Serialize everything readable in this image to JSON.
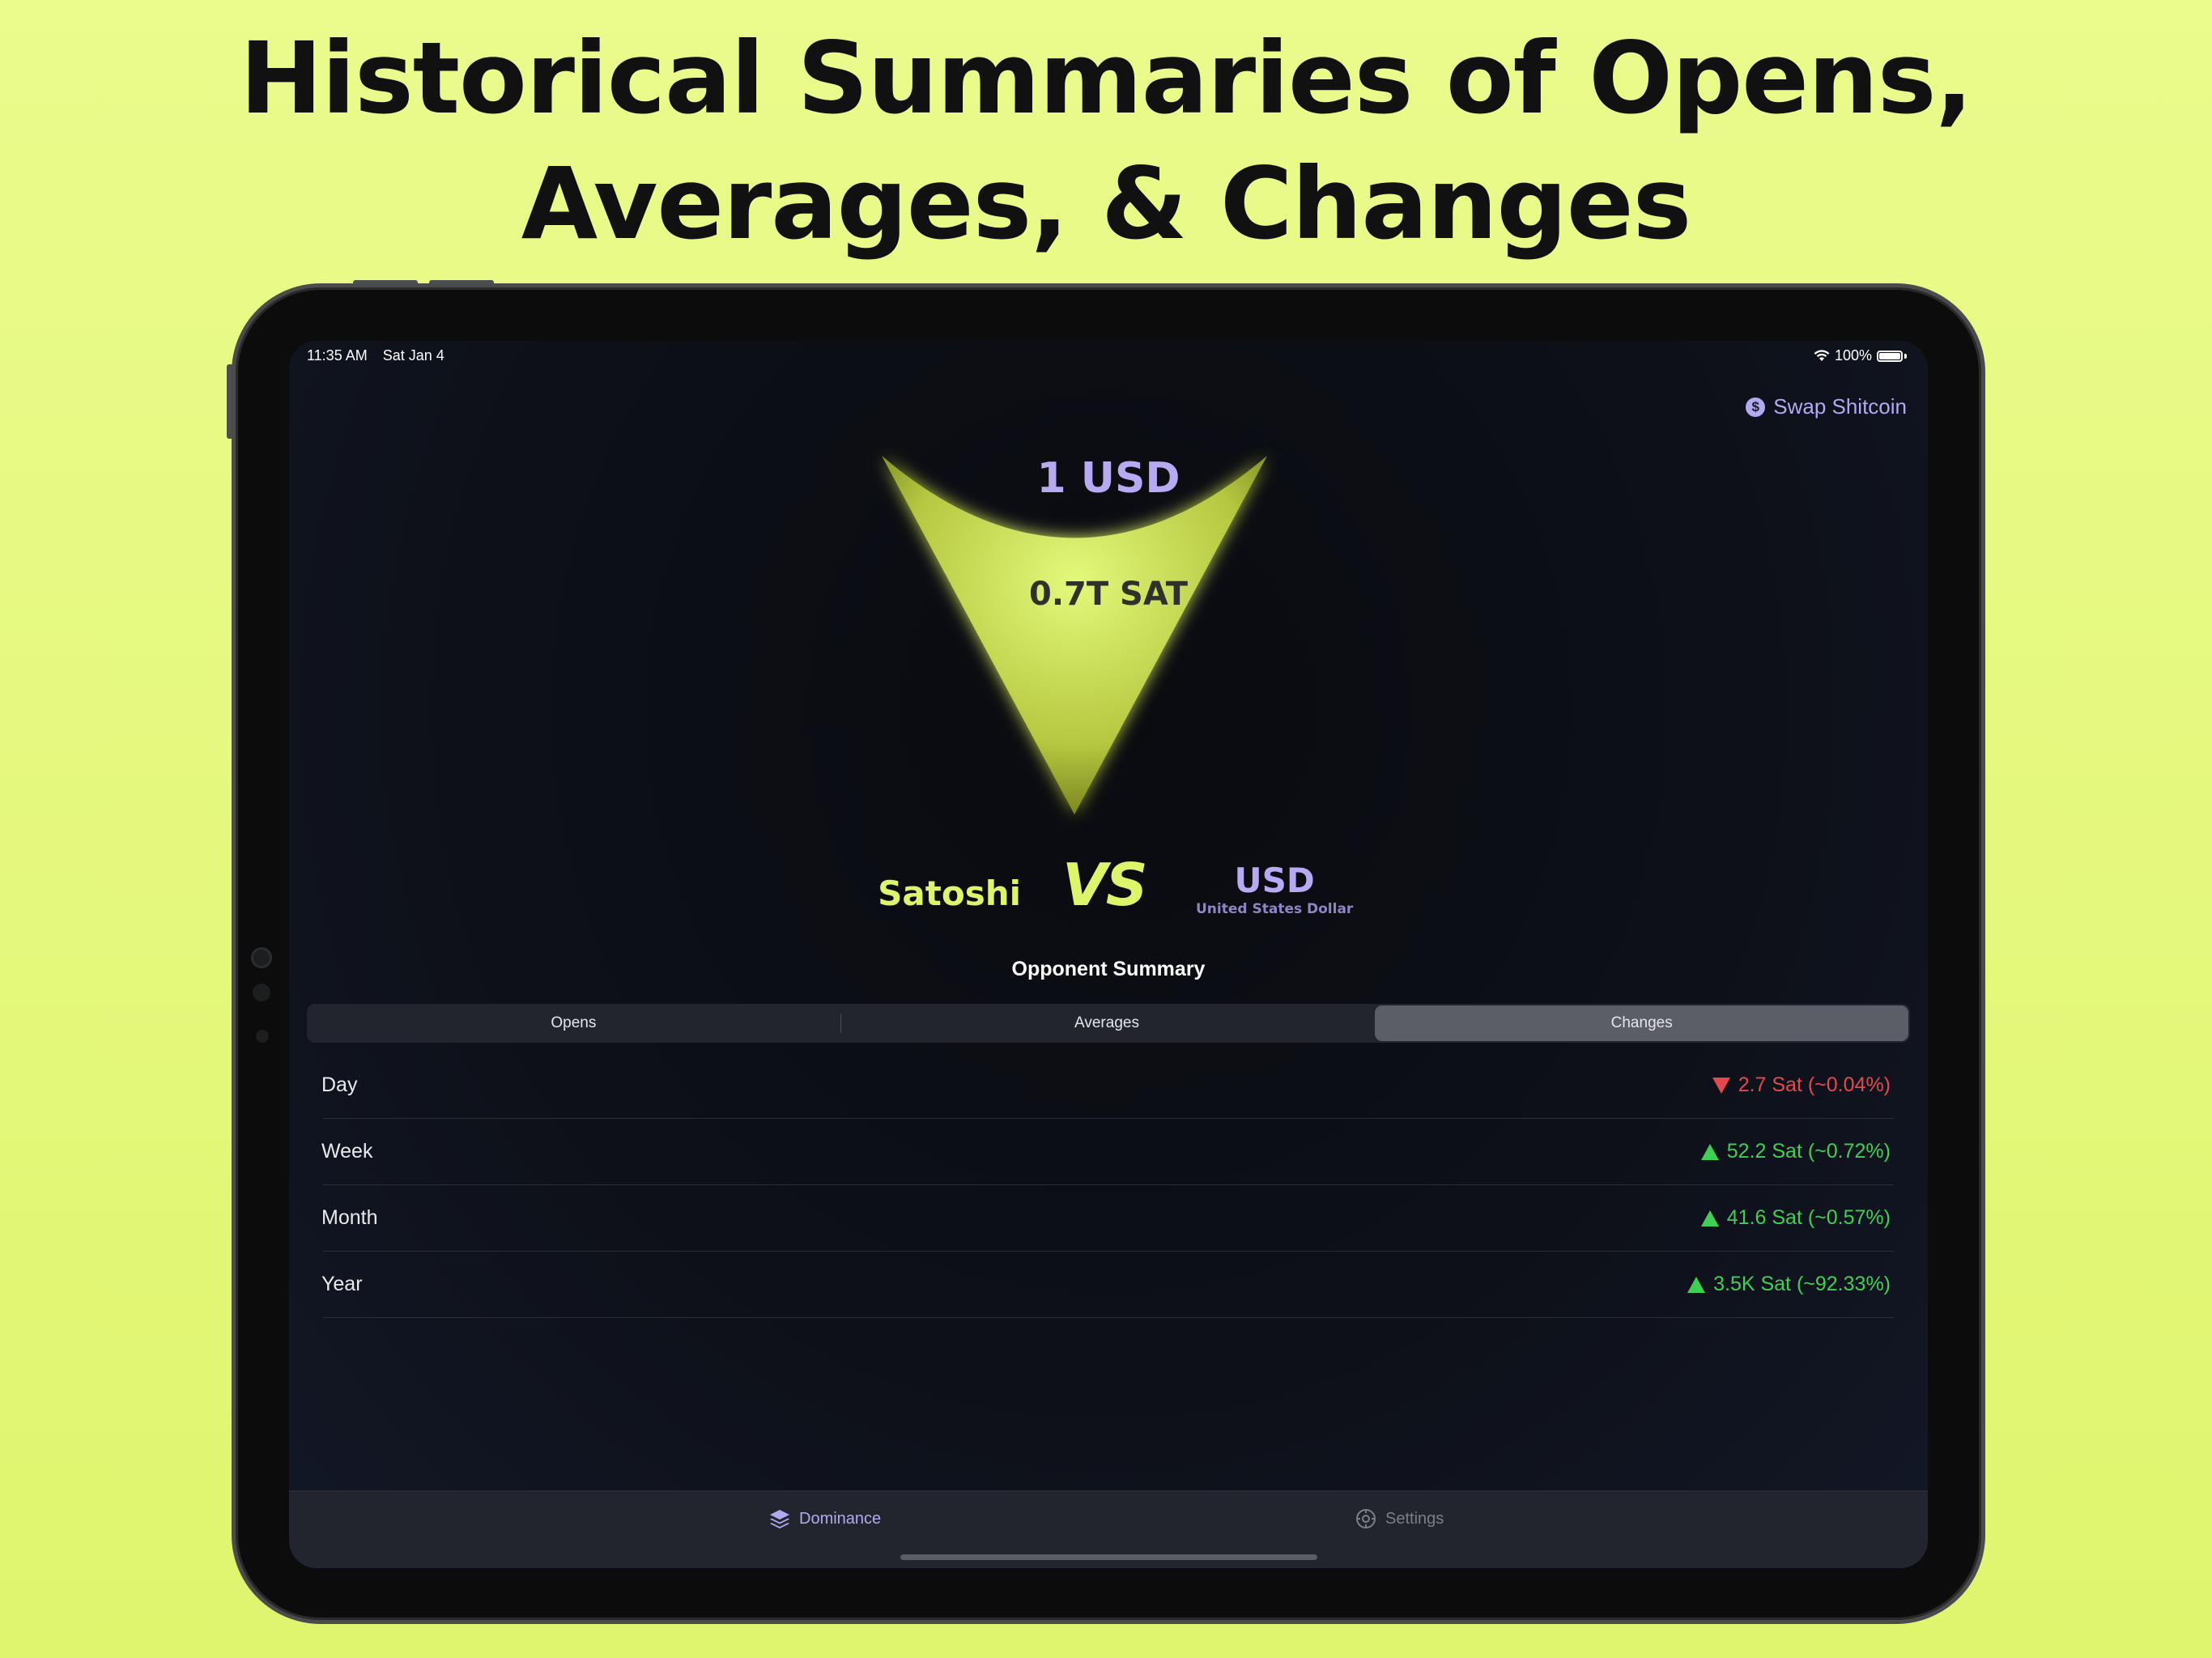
{
  "headline": {
    "line1": "Historical Summaries of Opens,",
    "line2": "Averages, & Changes"
  },
  "status_bar": {
    "time": "11:35 AM",
    "date": "Sat Jan 4",
    "battery": "100%"
  },
  "header": {
    "swap_label": "Swap Shitcoin"
  },
  "hero": {
    "top_value": "1 USD",
    "bottom_value": "0.7T SAT"
  },
  "matchup": {
    "left": "Satoshi",
    "vs": "VS",
    "right_code": "USD",
    "right_name": "United States Dollar"
  },
  "summary": {
    "title": "Opponent Summary",
    "tabs": [
      {
        "label": "Opens"
      },
      {
        "label": "Averages"
      },
      {
        "label": "Changes"
      }
    ],
    "active_tab": "Changes",
    "rows": [
      {
        "label": "Day",
        "value": "2.7 Sat (~0.04%)",
        "direction": "down"
      },
      {
        "label": "Week",
        "value": "52.2 Sat (~0.72%)",
        "direction": "up"
      },
      {
        "label": "Month",
        "value": "41.6 Sat (~0.57%)",
        "direction": "up"
      },
      {
        "label": "Year",
        "value": "3.5K Sat (~92.33%)",
        "direction": "up"
      }
    ]
  },
  "tabbar": {
    "items": [
      {
        "label": "Dominance",
        "icon": "layers-icon",
        "active": true
      },
      {
        "label": "Settings",
        "icon": "gear-icon",
        "active": false
      }
    ]
  },
  "colors": {
    "accent": "#dcf56a",
    "purple": "#b7aaf3",
    "up": "#3fcf55",
    "down": "#e5484d"
  }
}
